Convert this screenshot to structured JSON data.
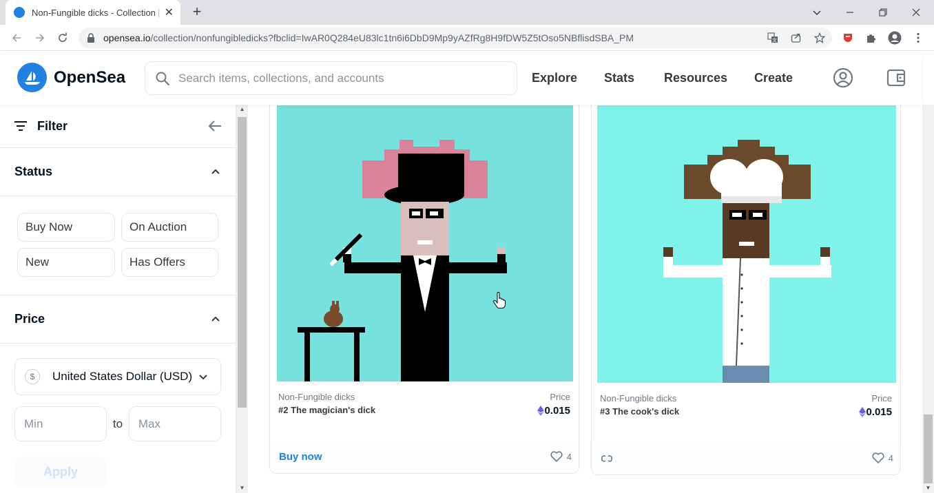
{
  "browser": {
    "tab_title": "Non-Fungible dicks - Collection | ",
    "url_host": "opensea.io",
    "url_path": "/collection/nonfungibledicks?fbclid=IwAR0Q284eU83lc1tn6i6DbD9Mp9yAZfRg8H9fDW5Z5tOso5NBflisdSBA_PM"
  },
  "header": {
    "brand": "OpenSea",
    "search_placeholder": "Search items, collections, and accounts",
    "nav": [
      "Explore",
      "Stats",
      "Resources",
      "Create"
    ]
  },
  "sidebar": {
    "filter_label": "Filter",
    "status": {
      "title": "Status",
      "options": [
        "Buy Now",
        "On Auction",
        "New",
        "Has Offers"
      ]
    },
    "price": {
      "title": "Price",
      "currency_symbol": "$",
      "currency": "United States Dollar (USD)",
      "min_placeholder": "Min",
      "to_label": "to",
      "max_placeholder": "Max",
      "apply_label": "Apply"
    }
  },
  "cards": [
    {
      "collection": "Non-Fungible dicks",
      "name": "#2 The magician's dick",
      "price_label": "Price",
      "price": "0.015",
      "action": "Buy now",
      "likes": "4"
    },
    {
      "collection": "Non-Fungible dicks",
      "name": "#3 The cook's dick",
      "price_label": "Price",
      "price": "0.015",
      "likes": "4"
    }
  ],
  "colors": {
    "brand": "#2081e2",
    "card_bg_1": "#76e1dd",
    "card_bg_2": "#7ff3e9"
  }
}
